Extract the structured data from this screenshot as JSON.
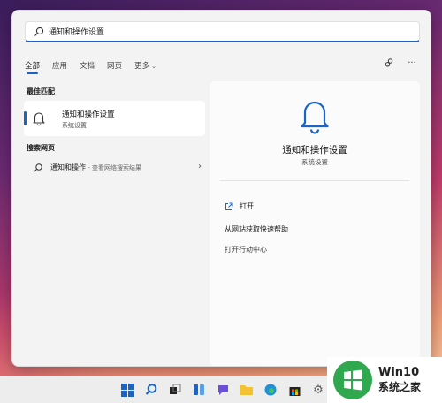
{
  "search": {
    "value": "通知和操作设置",
    "placeholder": ""
  },
  "tabs": [
    {
      "label": "全部",
      "active": true
    },
    {
      "label": "应用",
      "active": false
    },
    {
      "label": "文档",
      "active": false
    },
    {
      "label": "网页",
      "active": false
    },
    {
      "label": "更多",
      "active": false
    }
  ],
  "left": {
    "best_match_title": "最佳匹配",
    "best_match": {
      "title": "通知和操作设置",
      "subtitle": "系统设置",
      "icon": "bell-icon"
    },
    "web_title": "搜索网页",
    "web_result": {
      "query": "通知和操作",
      "hint": " - 查看网络搜索结果"
    }
  },
  "detail": {
    "title": "通知和操作设置",
    "subtitle": "系统设置",
    "actions": [
      {
        "label": "打开",
        "icon": "open-external-icon"
      },
      {
        "label": "从网站获取快速帮助",
        "icon": ""
      },
      {
        "label": "打开行动中心",
        "icon": ""
      }
    ]
  },
  "watermark": {
    "line1": "Win10",
    "line2": "系统之家"
  },
  "colors": {
    "accent": "#1a64c7",
    "panel": "#f3f3f3",
    "watermark_green": "#2fa84f"
  }
}
